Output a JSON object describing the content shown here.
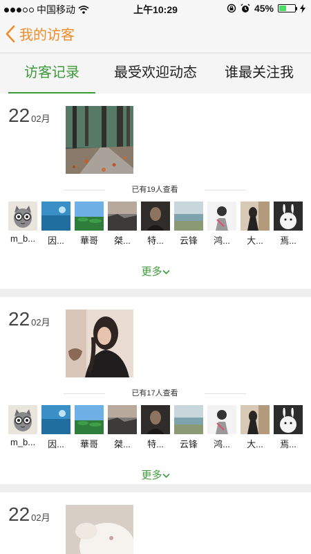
{
  "status_bar": {
    "carrier": "中国移动",
    "time": "上午10:29",
    "battery_percent": "45%",
    "battery_level": 0.45,
    "battery_color": "#4cd964",
    "icons": [
      "signal-dots-icon",
      "wifi-icon",
      "rotation-lock-icon",
      "alarm-icon",
      "battery-icon",
      "charging-icon"
    ]
  },
  "nav": {
    "back_icon": "chevron-left-icon",
    "title": "我的访客",
    "accent_color": "#f08c28"
  },
  "tabs": [
    {
      "label": "访客记录",
      "active": true
    },
    {
      "label": "最受欢迎动态",
      "active": false
    },
    {
      "label": "谁最关注我",
      "active": false
    }
  ],
  "theme": {
    "active_color": "#3d9a3a"
  },
  "visitor_names": [
    "m_b...",
    "因...",
    "華哥",
    "桀...",
    "特...",
    "云锋",
    "鸿...",
    "大...",
    "焉..."
  ],
  "posts": [
    {
      "day": "22",
      "month": "02月",
      "photo": "forest-path-photo",
      "view_count": "已有19人查看",
      "more_label": "更多",
      "more_icon": "chevron-down-icon"
    },
    {
      "day": "22",
      "month": "02月",
      "photo": "girl-portrait-photo",
      "view_count": "已有17人查看",
      "more_label": "更多",
      "more_icon": "chevron-down-icon"
    },
    {
      "day": "22",
      "month": "02月",
      "photo": "white-animal-photo"
    }
  ]
}
